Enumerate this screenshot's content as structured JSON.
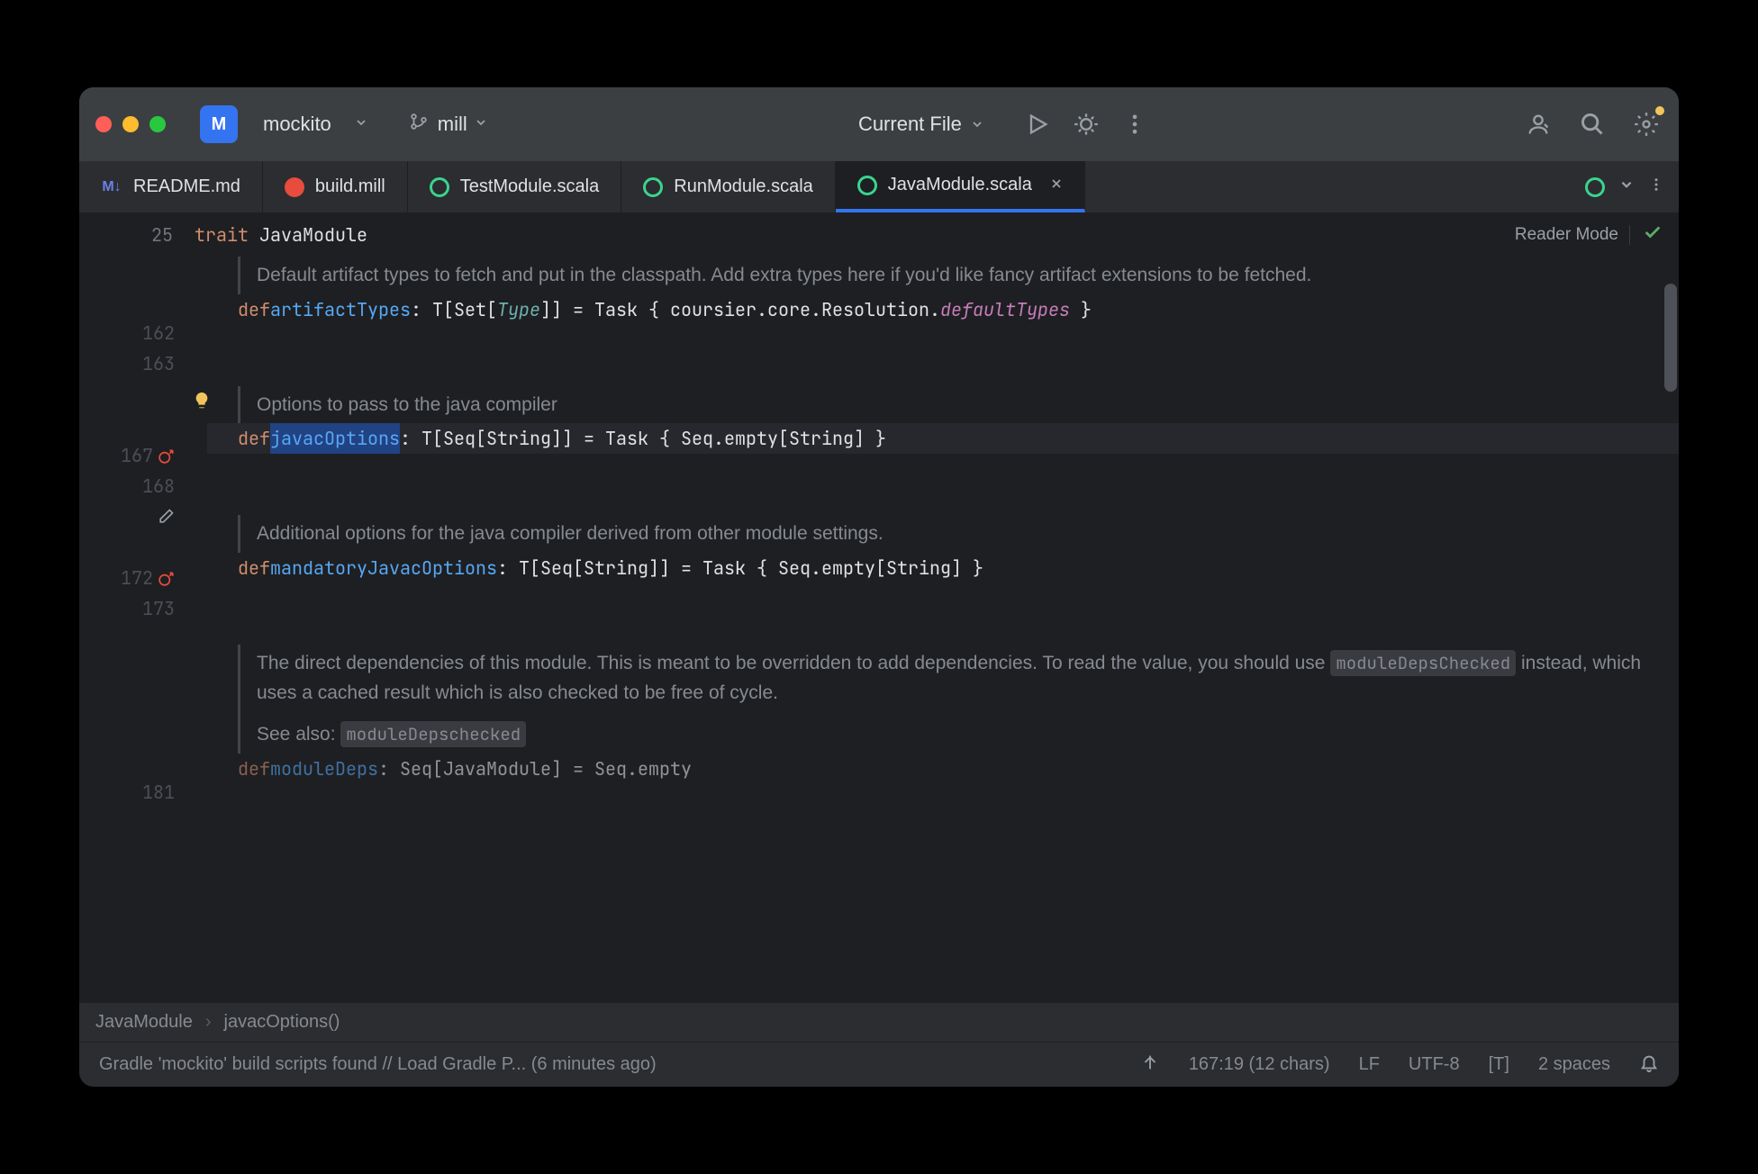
{
  "project": {
    "badge": "M",
    "name": "mockito",
    "branch": "mill"
  },
  "run_config": "Current File",
  "tabs": [
    {
      "icon": "markdown",
      "label": "README.md"
    },
    {
      "icon": "mill",
      "label": "build.mill"
    },
    {
      "icon": "scala",
      "label": "TestModule.scala"
    },
    {
      "icon": "scala",
      "label": "RunModule.scala"
    },
    {
      "icon": "scala",
      "label": "JavaModule.scala",
      "active": true,
      "closeable": true
    }
  ],
  "header": {
    "line": "25",
    "trait_kw": "trait",
    "trait_name": "JavaModule",
    "reader_mode": "Reader Mode"
  },
  "doc1": "Default artifact types to fetch and put in the classpath. Add extra types here if you'd like fancy artifact extensions to be fetched.",
  "line162": {
    "num": "162",
    "def": "def",
    "name": "artifactTypes",
    "sig1": ": T[Set[",
    "type": "Type",
    "sig2": "]] = Task { coursier.core.Resolution.",
    "call": "defaultTypes",
    "sig3": " }"
  },
  "line163": "163",
  "doc2": "Options to pass to the java compiler",
  "line167": {
    "num": "167",
    "def": "def",
    "name": "javacOptions",
    "sig": ": T[Seq[String]] = Task { Seq.empty[String] }"
  },
  "line168": "168",
  "doc3": "Additional options for the java compiler derived from other module settings.",
  "line172": {
    "num": "172",
    "def": "def",
    "name": "mandatoryJavacOptions",
    "sig": ": T[Seq[String]] = Task { Seq.empty[String] }"
  },
  "line173": "173",
  "doc4a": "The direct dependencies of this module. This is meant to be overridden to add dependencies. To read the value, you should use ",
  "doc4_code1": "moduleDepsChecked",
  "doc4b": " instead, which uses a cached result which is also checked to be free of cycle.",
  "doc4c": "See also: ",
  "doc4_code2": "moduleDepschecked",
  "line181": {
    "num": "181",
    "def": "def",
    "name": "moduleDeps",
    "sig": ": Seq[JavaModule] = Seq.empty"
  },
  "breadcrumb": {
    "part1": "JavaModule",
    "part2": "javacOptions()"
  },
  "status": {
    "message": "Gradle 'mockito' build scripts found // Load Gradle P... (6 minutes ago)",
    "position": "167:19 (12 chars)",
    "line_sep": "LF",
    "encoding": "UTF-8",
    "editorconfig": "[T]",
    "indent": "2 spaces"
  }
}
